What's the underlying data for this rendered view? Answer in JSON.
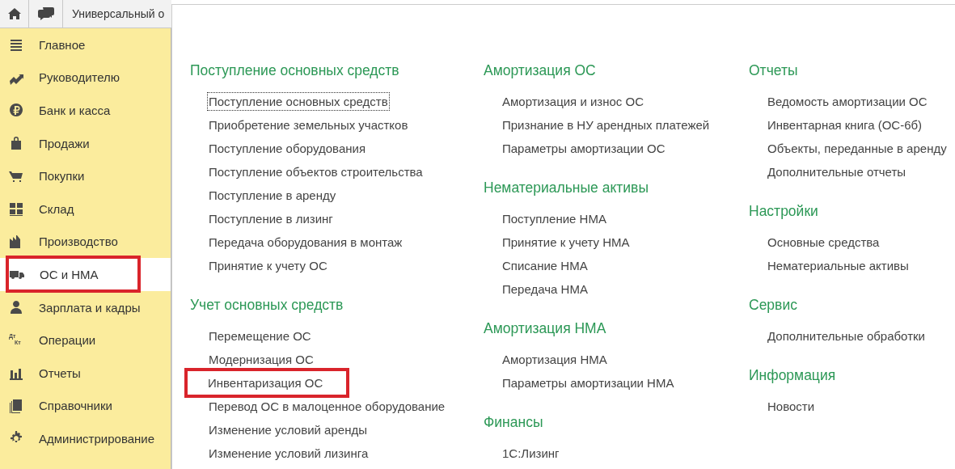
{
  "top_bar": {
    "title": "Универсальный о"
  },
  "sidebar": {
    "items": [
      {
        "label": "Главное",
        "selected": false,
        "highlighted": false
      },
      {
        "label": "Руководителю",
        "selected": false,
        "highlighted": false
      },
      {
        "label": "Банк и касса",
        "selected": false,
        "highlighted": false
      },
      {
        "label": "Продажи",
        "selected": false,
        "highlighted": false
      },
      {
        "label": "Покупки",
        "selected": false,
        "highlighted": false
      },
      {
        "label": "Склад",
        "selected": false,
        "highlighted": false
      },
      {
        "label": "Производство",
        "selected": false,
        "highlighted": false
      },
      {
        "label": "ОС и НМА",
        "selected": true,
        "highlighted": true
      },
      {
        "label": "Зарплата и кадры",
        "selected": false,
        "highlighted": false
      },
      {
        "label": "Операции",
        "selected": false,
        "highlighted": false,
        "icon_text": [
          "Дт",
          "Кт"
        ]
      },
      {
        "label": "Отчеты",
        "selected": false,
        "highlighted": false
      },
      {
        "label": "Справочники",
        "selected": false,
        "highlighted": false
      },
      {
        "label": "Администрирование",
        "selected": false,
        "highlighted": false
      }
    ]
  },
  "menu": {
    "columns": [
      {
        "sections": [
          {
            "title": "Поступление основных средств",
            "items": [
              {
                "label": "Поступление основных средств",
                "focused": true,
                "highlighted": false
              },
              {
                "label": "Приобретение земельных участков",
                "focused": false,
                "highlighted": false
              },
              {
                "label": "Поступление оборудования",
                "focused": false,
                "highlighted": false
              },
              {
                "label": "Поступление объектов строительства",
                "focused": false,
                "highlighted": false
              },
              {
                "label": "Поступление в аренду",
                "focused": false,
                "highlighted": false
              },
              {
                "label": "Поступление в лизинг",
                "focused": false,
                "highlighted": false
              },
              {
                "label": "Передача оборудования в монтаж",
                "focused": false,
                "highlighted": false
              },
              {
                "label": "Принятие к учету ОС",
                "focused": false,
                "highlighted": false
              }
            ]
          },
          {
            "title": "Учет основных средств",
            "items": [
              {
                "label": "Перемещение ОС",
                "focused": false,
                "highlighted": false
              },
              {
                "label": "Модернизация ОС",
                "focused": false,
                "highlighted": false
              },
              {
                "label": "Инвентаризация ОС",
                "focused": false,
                "highlighted": true
              },
              {
                "label": "Перевод ОС в малоценное оборудование",
                "focused": false,
                "highlighted": false
              },
              {
                "label": "Изменение условий аренды",
                "focused": false,
                "highlighted": false
              },
              {
                "label": "Изменение условий лизинга",
                "focused": false,
                "highlighted": false
              }
            ]
          }
        ]
      },
      {
        "sections": [
          {
            "title": "Амортизация ОС",
            "items": [
              {
                "label": "Амортизация и износ ОС",
                "focused": false,
                "highlighted": false
              },
              {
                "label": "Признание в НУ арендных платежей",
                "focused": false,
                "highlighted": false
              },
              {
                "label": "Параметры амортизации ОС",
                "focused": false,
                "highlighted": false
              }
            ]
          },
          {
            "title": "Нематериальные активы",
            "items": [
              {
                "label": "Поступление НМА",
                "focused": false,
                "highlighted": false
              },
              {
                "label": "Принятие к учету НМА",
                "focused": false,
                "highlighted": false
              },
              {
                "label": "Списание НМА",
                "focused": false,
                "highlighted": false
              },
              {
                "label": "Передача НМА",
                "focused": false,
                "highlighted": false
              }
            ]
          },
          {
            "title": "Амортизация НМА",
            "items": [
              {
                "label": "Амортизация НМА",
                "focused": false,
                "highlighted": false
              },
              {
                "label": "Параметры амортизации НМА",
                "focused": false,
                "highlighted": false
              }
            ]
          },
          {
            "title": "Финансы",
            "items": [
              {
                "label": "1С:Лизинг",
                "focused": false,
                "highlighted": false
              }
            ]
          }
        ]
      },
      {
        "sections": [
          {
            "title": "Отчеты",
            "items": [
              {
                "label": "Ведомость амортизации ОС",
                "focused": false,
                "highlighted": false
              },
              {
                "label": "Инвентарная книга (ОС-6б)",
                "focused": false,
                "highlighted": false
              },
              {
                "label": "Объекты, переданные в аренду",
                "focused": false,
                "highlighted": false
              },
              {
                "label": "Дополнительные отчеты",
                "focused": false,
                "highlighted": false
              }
            ]
          },
          {
            "title": "Настройки",
            "items": [
              {
                "label": "Основные средства",
                "focused": false,
                "highlighted": false
              },
              {
                "label": "Нематериальные активы",
                "focused": false,
                "highlighted": false
              }
            ]
          },
          {
            "title": "Сервис",
            "items": [
              {
                "label": "Дополнительные обработки",
                "focused": false,
                "highlighted": false
              }
            ]
          },
          {
            "title": "Информация",
            "items": [
              {
                "label": "Новости",
                "focused": false,
                "highlighted": false
              }
            ]
          }
        ]
      }
    ]
  }
}
